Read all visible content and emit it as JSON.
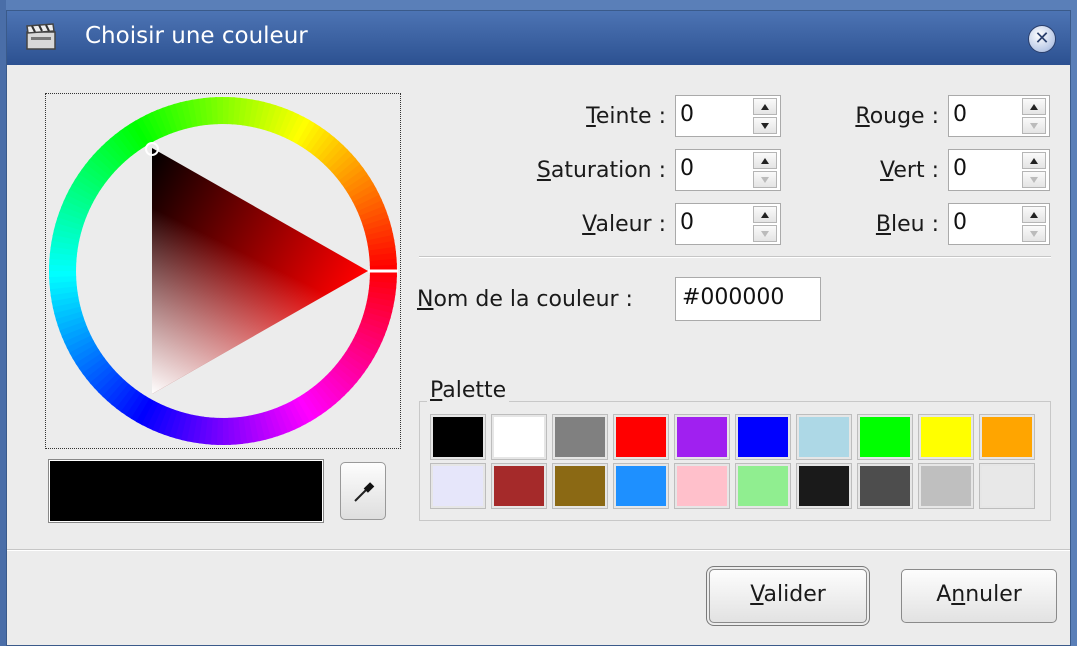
{
  "window": {
    "title": "Choisir une couleur"
  },
  "hsv": {
    "hue_label_ul": "T",
    "hue_label_rest": "einte :",
    "hue_value": "0",
    "sat_label_ul": "S",
    "sat_label_rest": "aturation :",
    "sat_value": "0",
    "val_label_ul": "V",
    "val_label_rest": "aleur :",
    "val_value": "0"
  },
  "rgb": {
    "red_label_ul": "R",
    "red_label_rest": "ouge :",
    "red_value": "0",
    "green_label_ul": "V",
    "green_label_rest": "ert :",
    "green_value": "0",
    "blue_label_ul": "B",
    "blue_label_rest": "leu :",
    "blue_value": "0"
  },
  "color_name": {
    "label_ul": "N",
    "label_rest": "om de la couleur :",
    "value": "#000000"
  },
  "current_color": "#000000",
  "palette": {
    "label_ul": "P",
    "label_rest": "alette",
    "colors": [
      "#000000",
      "#ffffff",
      "#808080",
      "#ff0000",
      "#a020f0",
      "#0000ff",
      "#add8e6",
      "#00ff00",
      "#ffff00",
      "#ffa500",
      "#e6e6fa",
      "#a52a2a",
      "#8b6914",
      "#1e90ff",
      "#ffc0cb",
      "#90ee90",
      "#1a1a1a",
      "#4d4d4d",
      "#bfbfbf",
      "#e8e8e8"
    ]
  },
  "buttons": {
    "ok_ul": "V",
    "ok_rest": "alider",
    "cancel_pre": "A",
    "cancel_ul": "n",
    "cancel_rest": "nuler"
  },
  "icons": {
    "window_icon": "clapperboard-icon",
    "close": "close-icon",
    "eyedropper": "eyedropper-icon"
  }
}
